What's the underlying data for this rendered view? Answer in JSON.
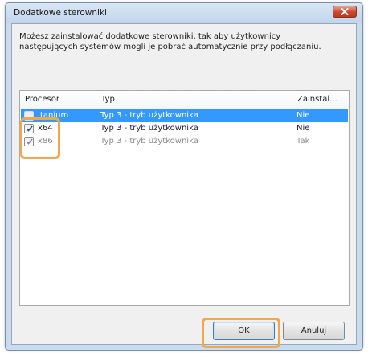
{
  "dialog": {
    "title": "Dodatkowe sterowniki",
    "description": "Możesz zainstalować dodatkowe sterowniki, tak aby użytkownicy\nnastępujących systemów mogli je pobrać automatycznie przy podłączaniu."
  },
  "table": {
    "headers": {
      "processor": "Procesor",
      "type": "Typ",
      "installed": "Zainstal..."
    },
    "rows": [
      {
        "processor": "Itanium",
        "type": "Typ 3 - tryb użytkownika",
        "installed": "Nie",
        "checked": false,
        "selected": true
      },
      {
        "processor": "x64",
        "type": "Typ 3 - tryb użytkownika",
        "installed": "Nie",
        "checked": true,
        "selected": false
      },
      {
        "processor": "x86",
        "type": "Typ 3 - tryb użytkownika",
        "installed": "Tak",
        "checked": true,
        "selected": false
      }
    ]
  },
  "buttons": {
    "ok": "OK",
    "cancel": "Anuluj"
  },
  "colors": {
    "selection": "#3399ff",
    "highlight": "#f3a64a",
    "close": "#c8472d"
  },
  "icons": {
    "close": "close-icon",
    "check": "checkmark-icon"
  }
}
